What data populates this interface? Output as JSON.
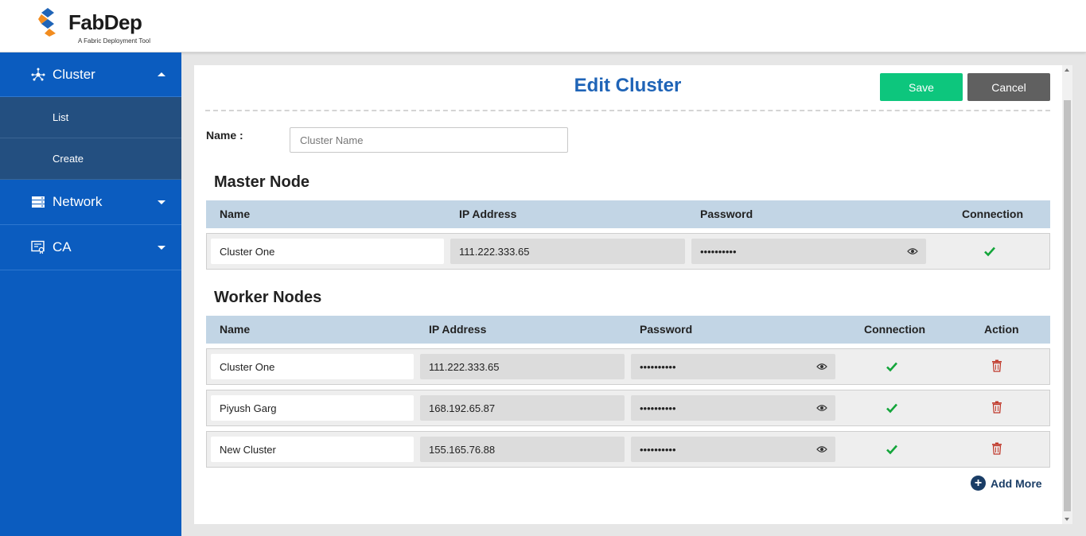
{
  "app": {
    "name": "FabDep",
    "tagline": "A Fabric Deployment Tool",
    "colors": {
      "sidebar": "#0b5cbf",
      "submenu": "#234f80",
      "title": "#1f64b7",
      "save": "#0dc67d",
      "cancel": "#606060",
      "table_header": "#c2d5e5",
      "check": "#13a53a",
      "trash": "#c0392b"
    }
  },
  "sidebar": {
    "items": [
      {
        "label": "Cluster",
        "icon": "cluster-icon",
        "expanded": true,
        "children": [
          {
            "label": "List"
          },
          {
            "label": "Create"
          }
        ]
      },
      {
        "label": "Network",
        "icon": "server-icon",
        "expanded": false
      },
      {
        "label": "CA",
        "icon": "certificate-icon",
        "expanded": false
      }
    ]
  },
  "page": {
    "title": "Edit Cluster",
    "save_label": "Save",
    "cancel_label": "Cancel",
    "name_label": "Name :",
    "name_placeholder": "Cluster Name",
    "add_more_label": "Add More"
  },
  "master": {
    "title": "Master Node",
    "headers": {
      "name": "Name",
      "ip": "IP Address",
      "password": "Password",
      "connection": "Connection"
    },
    "rows": [
      {
        "name": "Cluster One",
        "ip": "111.222.333.65",
        "password": "••••••••••",
        "connected": true
      }
    ]
  },
  "workers": {
    "title": "Worker Nodes",
    "headers": {
      "name": "Name",
      "ip": "IP Address",
      "password": "Password",
      "connection": "Connection",
      "action": "Action"
    },
    "rows": [
      {
        "name": "Cluster One",
        "ip": "111.222.333.65",
        "password": "••••••••••",
        "connected": true
      },
      {
        "name": "Piyush Garg",
        "ip": "168.192.65.87",
        "password": "••••••••••",
        "connected": true
      },
      {
        "name": "New Cluster",
        "ip": "155.165.76.88",
        "password": "••••••••••",
        "connected": true
      }
    ]
  }
}
